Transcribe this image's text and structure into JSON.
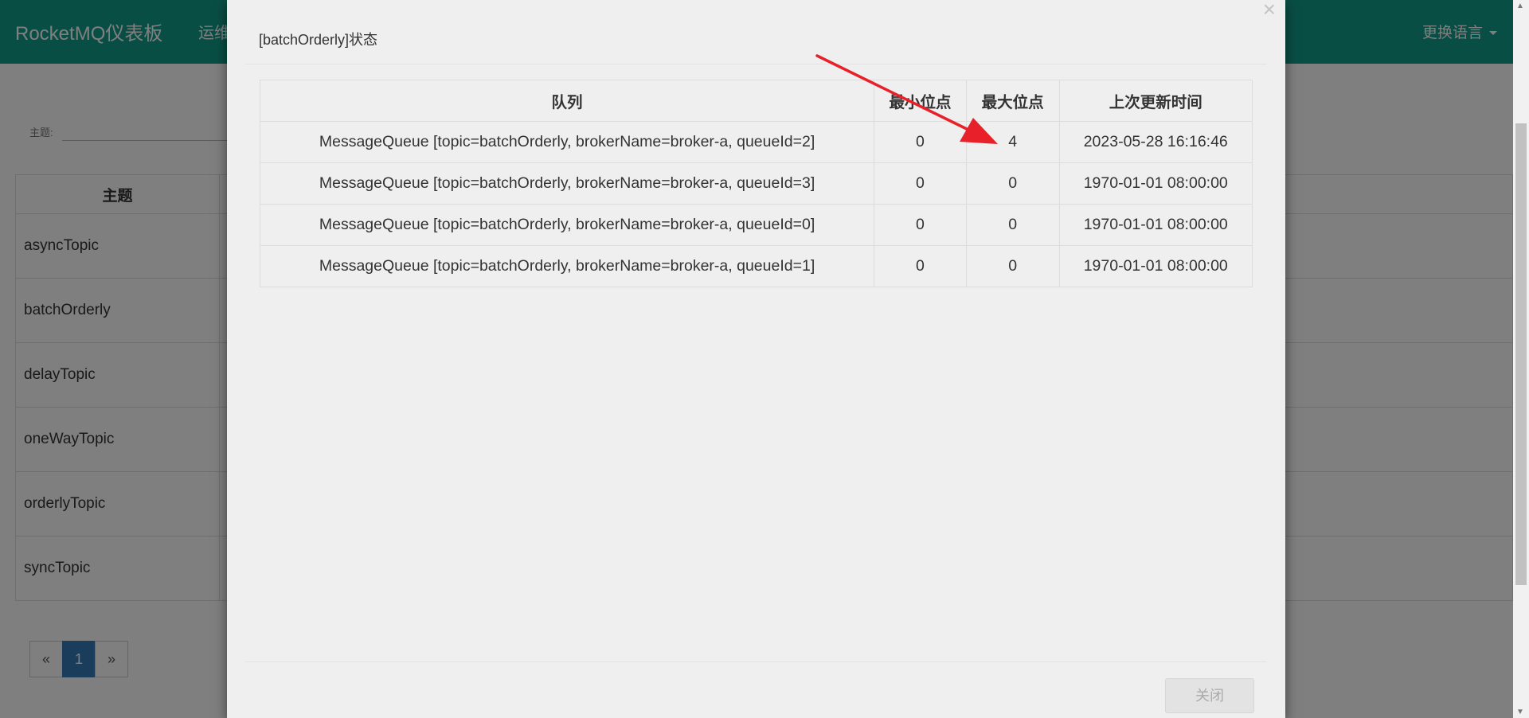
{
  "app": {
    "brand": "RocketMQ仪表板",
    "nav_ops": "运维",
    "language": "更换语言"
  },
  "filter": {
    "label": "主题:"
  },
  "topic_table": {
    "header": "主题",
    "rows": [
      "asyncTopic",
      "batchOrderly",
      "delayTopic",
      "oneWayTopic",
      "orderlyTopic",
      "syncTopic"
    ]
  },
  "pagination": {
    "prev": "«",
    "current": "1",
    "next": "»"
  },
  "modal": {
    "title": "[batchOrderly]状态",
    "close_icon": "×",
    "headers": [
      "队列",
      "最小位点",
      "最大位点",
      "上次更新时间"
    ],
    "rows": [
      [
        "MessageQueue [topic=batchOrderly, brokerName=broker-a, queueId=2]",
        "0",
        "4",
        "2023-05-28 16:16:46"
      ],
      [
        "MessageQueue [topic=batchOrderly, brokerName=broker-a, queueId=3]",
        "0",
        "0",
        "1970-01-01 08:00:00"
      ],
      [
        "MessageQueue [topic=batchOrderly, brokerName=broker-a, queueId=0]",
        "0",
        "0",
        "1970-01-01 08:00:00"
      ],
      [
        "MessageQueue [topic=batchOrderly, brokerName=broker-a, queueId=1]",
        "0",
        "0",
        "1970-01-01 08:00:00"
      ]
    ],
    "close_button": "关闭"
  },
  "colors": {
    "navbar": "#139c8b",
    "annotation_arrow": "#e8202a",
    "pager_active": "#337ab7"
  },
  "icons": [
    "close-icon",
    "caret-down-icon",
    "annotation-arrow-icon"
  ]
}
